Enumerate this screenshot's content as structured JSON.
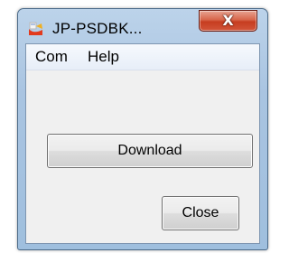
{
  "window": {
    "title": "JP-PSDBK...",
    "app_icon": "app-icon",
    "close_glyph": "X"
  },
  "menubar": {
    "items": [
      {
        "label": "Com"
      },
      {
        "label": "Help"
      }
    ]
  },
  "buttons": {
    "download_label": "Download",
    "close_label": "Close"
  },
  "colors": {
    "titlebar": "#a9c4e1",
    "close_button": "#c63d20",
    "client_bg": "#f0f0f0"
  }
}
